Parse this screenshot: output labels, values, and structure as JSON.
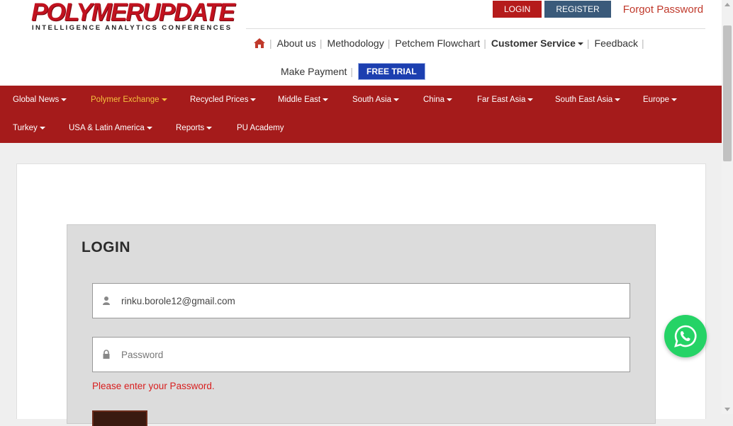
{
  "logo": {
    "main": "POLYMERUPDATE",
    "tagline": "INTELLIGENCE   ANALYTICS   CONFERENCES"
  },
  "top_buttons": {
    "login": "LOGIN",
    "register": "REGISTER",
    "forgot": "Forgot Password"
  },
  "secondary_nav": {
    "home_icon": "home-icon",
    "items": [
      "About us",
      "Methodology",
      "Petchem Flowchart",
      "Customer Service",
      "Feedback"
    ],
    "make_payment": "Make Payment",
    "free_trial": "FREE TRIAL"
  },
  "main_nav": {
    "row1": [
      "Global News",
      "Polymer Exchange",
      "Recycled Prices",
      "Middle East",
      "South Asia",
      "China",
      "Far East Asia",
      "South East Asia",
      "Europe"
    ],
    "row2": [
      "Turkey",
      "USA & Latin America",
      "Reports",
      "PU Academy"
    ],
    "active": "Polymer Exchange"
  },
  "login": {
    "title": "LOGIN",
    "email_value": "rinku.borole12@gmail.com",
    "password_placeholder": "Password",
    "error": "Please enter your Password."
  },
  "colors": {
    "brand_red": "#a51b1b",
    "active_nav": "#f6c23e",
    "register_blue": "#3a5a7a",
    "free_trial_blue": "#1c3fb0",
    "whatsapp": "#25d366"
  }
}
